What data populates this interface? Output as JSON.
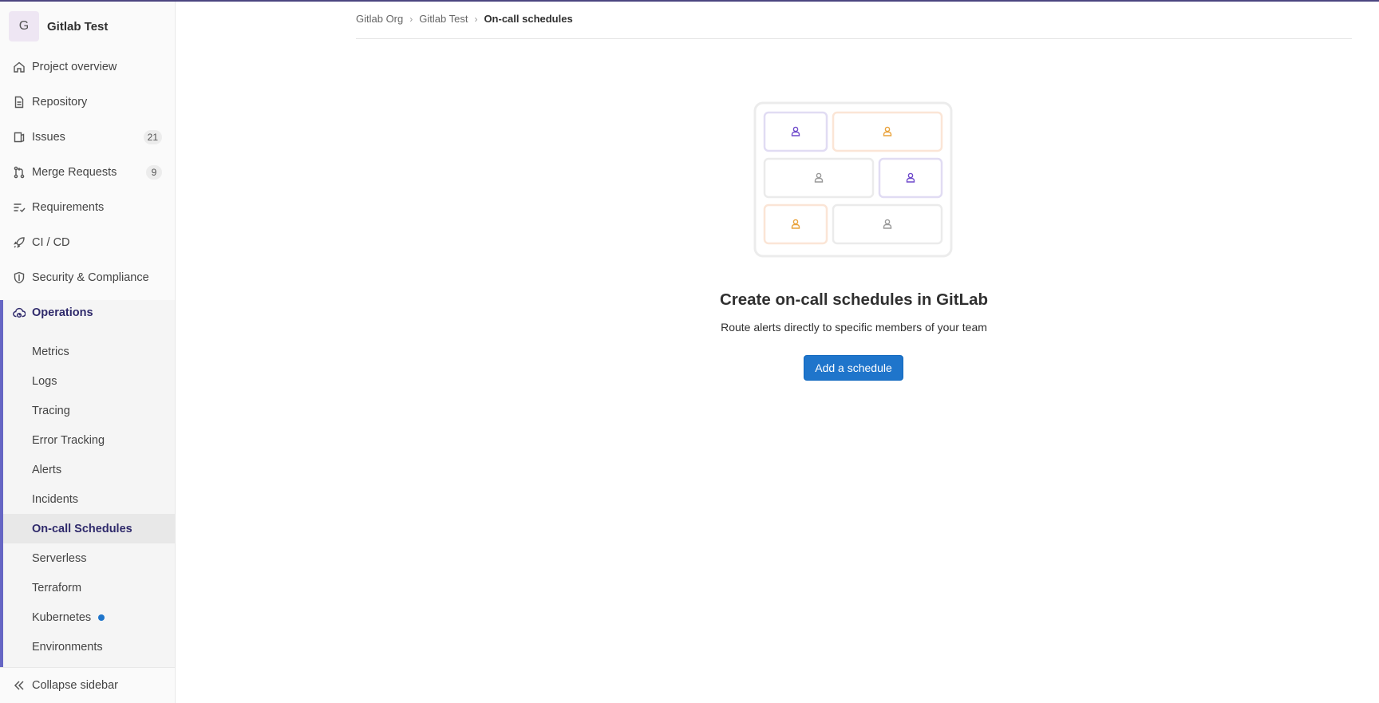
{
  "project": {
    "avatar_letter": "G",
    "name": "Gitlab Test"
  },
  "sidebar": {
    "items": [
      {
        "label": "Project overview"
      },
      {
        "label": "Repository"
      },
      {
        "label": "Issues",
        "badge": "21"
      },
      {
        "label": "Merge Requests",
        "badge": "9"
      },
      {
        "label": "Requirements"
      },
      {
        "label": "CI / CD"
      },
      {
        "label": "Security & Compliance"
      },
      {
        "label": "Operations"
      }
    ],
    "operations_sub": [
      {
        "label": "Metrics"
      },
      {
        "label": "Logs"
      },
      {
        "label": "Tracing"
      },
      {
        "label": "Error Tracking"
      },
      {
        "label": "Alerts"
      },
      {
        "label": "Incidents"
      },
      {
        "label": "On-call Schedules"
      },
      {
        "label": "Serverless"
      },
      {
        "label": "Terraform"
      },
      {
        "label": "Kubernetes"
      },
      {
        "label": "Environments"
      }
    ],
    "collapse_label": "Collapse sidebar"
  },
  "breadcrumb": {
    "items": [
      "Gitlab Org",
      "Gitlab Test"
    ],
    "current": "On-call schedules"
  },
  "empty_state": {
    "title": "Create on-call schedules in GitLab",
    "description": "Route alerts directly to specific members of your team",
    "button_label": "Add a schedule"
  },
  "colors": {
    "accent": "#1f75cb",
    "active_nav": "#2f2a6b",
    "ops_bar": "#6666c4",
    "purple": "#6e49cb",
    "orange": "#e9a23b"
  }
}
